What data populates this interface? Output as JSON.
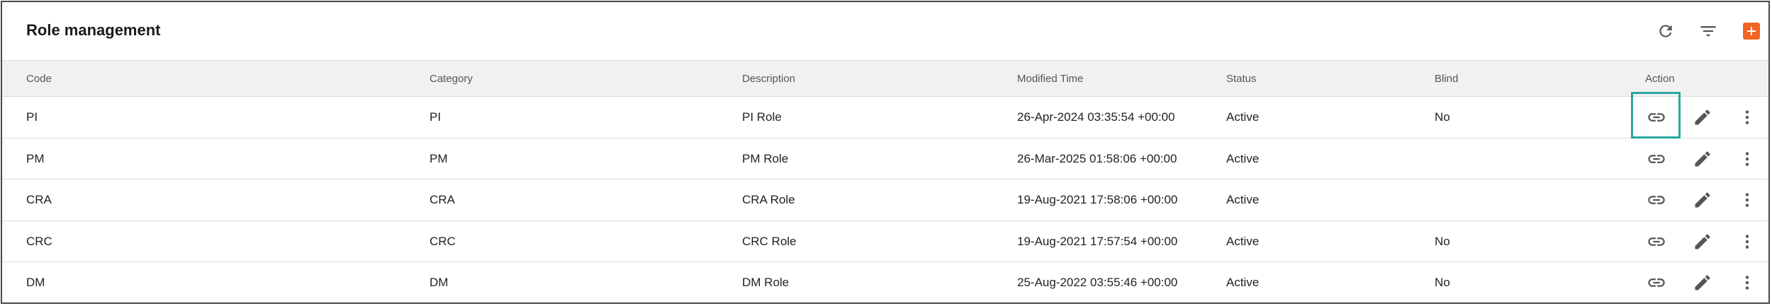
{
  "header": {
    "title": "Role management",
    "refresh_icon": "refresh-icon",
    "filter_icon": "filter-icon",
    "add_icon": "plus-icon",
    "accent_color": "#f26522"
  },
  "table": {
    "columns": [
      "Code",
      "Category",
      "Description",
      "Modified Time",
      "Status",
      "Blind",
      "Action"
    ],
    "rows": [
      {
        "code": "PI",
        "category": "PI",
        "description": "PI Role",
        "modified": "26-Apr-2024 03:35:54 +00:00",
        "status": "Active",
        "blind": "No"
      },
      {
        "code": "PM",
        "category": "PM",
        "description": "PM Role",
        "modified": "26-Mar-2025 01:58:06 +00:00",
        "status": "Active",
        "blind": ""
      },
      {
        "code": "CRA",
        "category": "CRA",
        "description": "CRA Role",
        "modified": "19-Aug-2021 17:58:06 +00:00",
        "status": "Active",
        "blind": ""
      },
      {
        "code": "CRC",
        "category": "CRC",
        "description": "CRC Role",
        "modified": "19-Aug-2021 17:57:54 +00:00",
        "status": "Active",
        "blind": "No"
      },
      {
        "code": "DM",
        "category": "DM",
        "description": "DM Role",
        "modified": "25-Aug-2022 03:55:46 +00:00",
        "status": "Active",
        "blind": "No"
      }
    ],
    "row_action_icons": [
      "link-icon",
      "pencil-icon",
      "more-vertical-icon"
    ],
    "focus_color": "#2aa89a"
  }
}
